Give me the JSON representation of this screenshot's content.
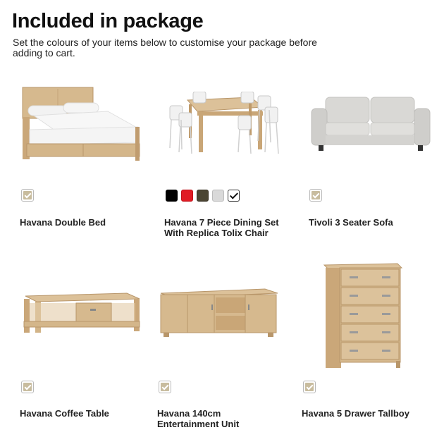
{
  "header": {
    "title": "Included in package",
    "subtitle": "Set the colours of your items below to customise your package before adding to cart."
  },
  "colors": {
    "checkbox_fill": "#c8bc9e",
    "wood": "#d2b48c",
    "wood_dark": "#b8966a",
    "sofa": "#d3d2cf"
  },
  "swatches": [
    {
      "name": "black",
      "color": "#000000"
    },
    {
      "name": "red",
      "color": "#e01b24"
    },
    {
      "name": "dark-olive",
      "color": "#4b4533"
    },
    {
      "name": "light-grey",
      "color": "#d9d9d9"
    },
    {
      "name": "white",
      "color": "#ffffff",
      "selected": true
    }
  ],
  "items": [
    {
      "name": "Havana Double Bed",
      "icon": "bed-image"
    },
    {
      "name": "Havana 7 Piece Dining Set\nWith Replica Tolix Chair",
      "icon": "dining-set-image"
    },
    {
      "name": "Tivoli 3 Seater Sofa",
      "icon": "sofa-image"
    },
    {
      "name": "Havana Coffee Table",
      "icon": "coffee-table-image"
    },
    {
      "name": "Havana 140cm\nEntertainment Unit",
      "icon": "tv-unit-image"
    },
    {
      "name": "Havana 5 Drawer Tallboy",
      "icon": "tallboy-image"
    }
  ]
}
